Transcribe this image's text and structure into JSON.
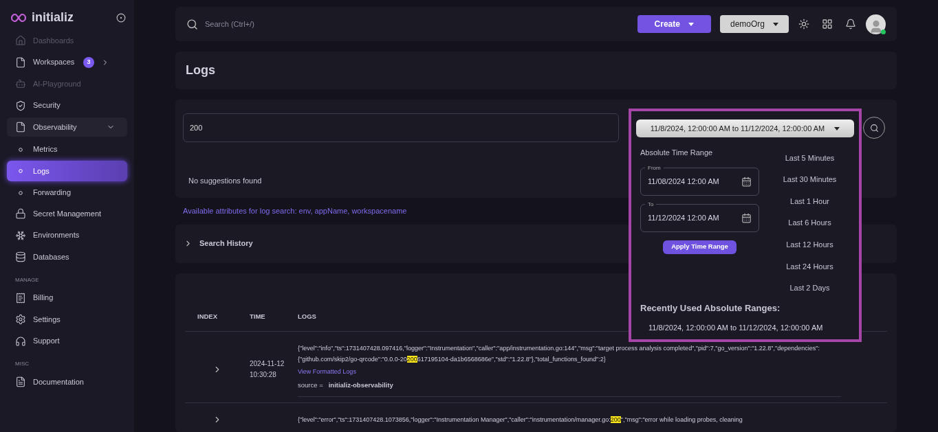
{
  "brand": {
    "name": "initializ"
  },
  "sidebar": {
    "items": [
      {
        "kind": "item",
        "label": "Dashboards",
        "disabled": true
      },
      {
        "kind": "group",
        "label": "Workspaces",
        "disabled": false,
        "badge": "3",
        "expanded": false
      },
      {
        "kind": "item",
        "label": "AI-Playground",
        "disabled": true
      },
      {
        "kind": "item",
        "label": "Security",
        "disabled": false
      },
      {
        "kind": "group",
        "label": "Observability",
        "disabled": false,
        "expanded": true,
        "children": [
          {
            "label": "Metrics",
            "selected": false
          },
          {
            "label": "Logs",
            "selected": true
          },
          {
            "label": "Forwarding",
            "selected": false
          }
        ]
      },
      {
        "kind": "item",
        "label": "Secret Management",
        "disabled": false
      },
      {
        "kind": "item",
        "label": "Environments",
        "disabled": false
      },
      {
        "kind": "item",
        "label": "Databases",
        "disabled": false
      },
      {
        "kind": "section",
        "label": "MANAGE"
      },
      {
        "kind": "item",
        "label": "Billing",
        "disabled": false
      },
      {
        "kind": "item",
        "label": "Settings",
        "disabled": false
      },
      {
        "kind": "item",
        "label": "Support",
        "disabled": false
      },
      {
        "kind": "section",
        "label": "MISC"
      },
      {
        "kind": "item",
        "label": "Documentation",
        "disabled": false
      }
    ]
  },
  "topbar": {
    "search": {
      "placeholder": "Search (Ctrl+/)"
    },
    "create": "Create",
    "org": "demoOrg"
  },
  "page": {
    "title": "Logs"
  },
  "query": {
    "value": "200",
    "suggestions": "No suggestions found",
    "attributes": "Available attributes for log search: env, appName, workspacename",
    "history": "Search History"
  },
  "time_range": {
    "label": "11/8/2024, 12:00:00 AM to 11/12/2024, 12:00:00 AM",
    "absolute_title": "Absolute Time Range",
    "from": {
      "label": "From",
      "value": "11/08/2024 12:00 AM"
    },
    "to": {
      "label": "To",
      "value": "11/12/2024 12:00 AM"
    },
    "apply": "Apply Time Range",
    "quick": [
      "Last 5 Minutes",
      "Last 30 Minutes",
      "Last 1 Hour",
      "Last 6 Hours",
      "Last 12 Hours",
      "Last 24 Hours",
      "Last 2 Days"
    ],
    "recent_title": "Recently Used Absolute Ranges:",
    "recent": [
      "11/8/2024, 12:00:00 AM to 11/12/2024, 12:00:00 AM"
    ]
  },
  "table": {
    "columns": [
      "INDEX",
      "TIME",
      "LOGS"
    ],
    "rows": [
      {
        "time": "2024-11-12 10:30:28",
        "expanded": false,
        "segments": [
          {
            "text": "{\"level\":\"info\",\"ts\":1731407428.097416,\"logger\":\"Instrumentation\",\"caller\":\"app/instrumentation.go:144\",\"msg\":\"target process analysis completed\",\"pid\":7,\"go_version\":\"1.22.8\",\"dependencies\":{\"github.com/skip2/go-qrcode\":\"0.0.0-20",
            "highlighted": false
          },
          {
            "text": "200",
            "highlighted": true
          },
          {
            "text": "617195104-da1b6568686e\",\"std\":\"1.22.8\"},\"total_functions_found\":2}",
            "highlighted": false
          }
        ],
        "link": "View Formatted Logs",
        "source_label": "source =",
        "source": "initializ-observability"
      },
      {
        "time": "",
        "expanded": false,
        "segments": [
          {
            "text": "{\"level\":\"error\",\"ts\":1731407428.1073856,\"logger\":\"Instrumentation Manager\",\"caller\":\"instrumentation/manager.go:",
            "highlighted": false
          },
          {
            "text": "200",
            "highlighted": true
          },
          {
            "text": "\",\"msg\":\"error while loading probes, cleaning",
            "highlighted": false
          }
        ]
      }
    ]
  }
}
